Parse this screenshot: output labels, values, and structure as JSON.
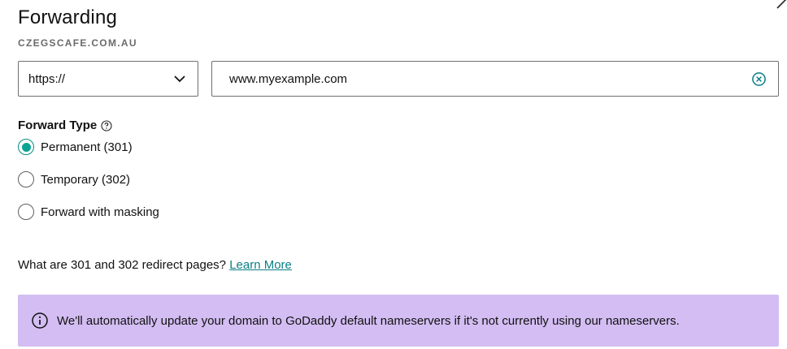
{
  "header": {
    "title": "Forwarding",
    "domain": "CZEGSCAFE.COM.AU"
  },
  "forward_to": {
    "protocol": "https://",
    "url_value": "www.myexample.com"
  },
  "forward_type": {
    "label": "Forward Type",
    "options": [
      {
        "label": "Permanent (301)",
        "selected": true
      },
      {
        "label": "Temporary (302)",
        "selected": false
      },
      {
        "label": "Forward with masking",
        "selected": false
      }
    ]
  },
  "help": {
    "question": "What are 301 and 302 redirect pages?",
    "link_text": "Learn More"
  },
  "banner": {
    "text": "We'll automatically update your domain to GoDaddy default nameservers if it's not currently using our nameservers."
  },
  "colors": {
    "accent": "#09a494",
    "link": "#0a7f86",
    "banner_bg": "#d3bdf2"
  }
}
